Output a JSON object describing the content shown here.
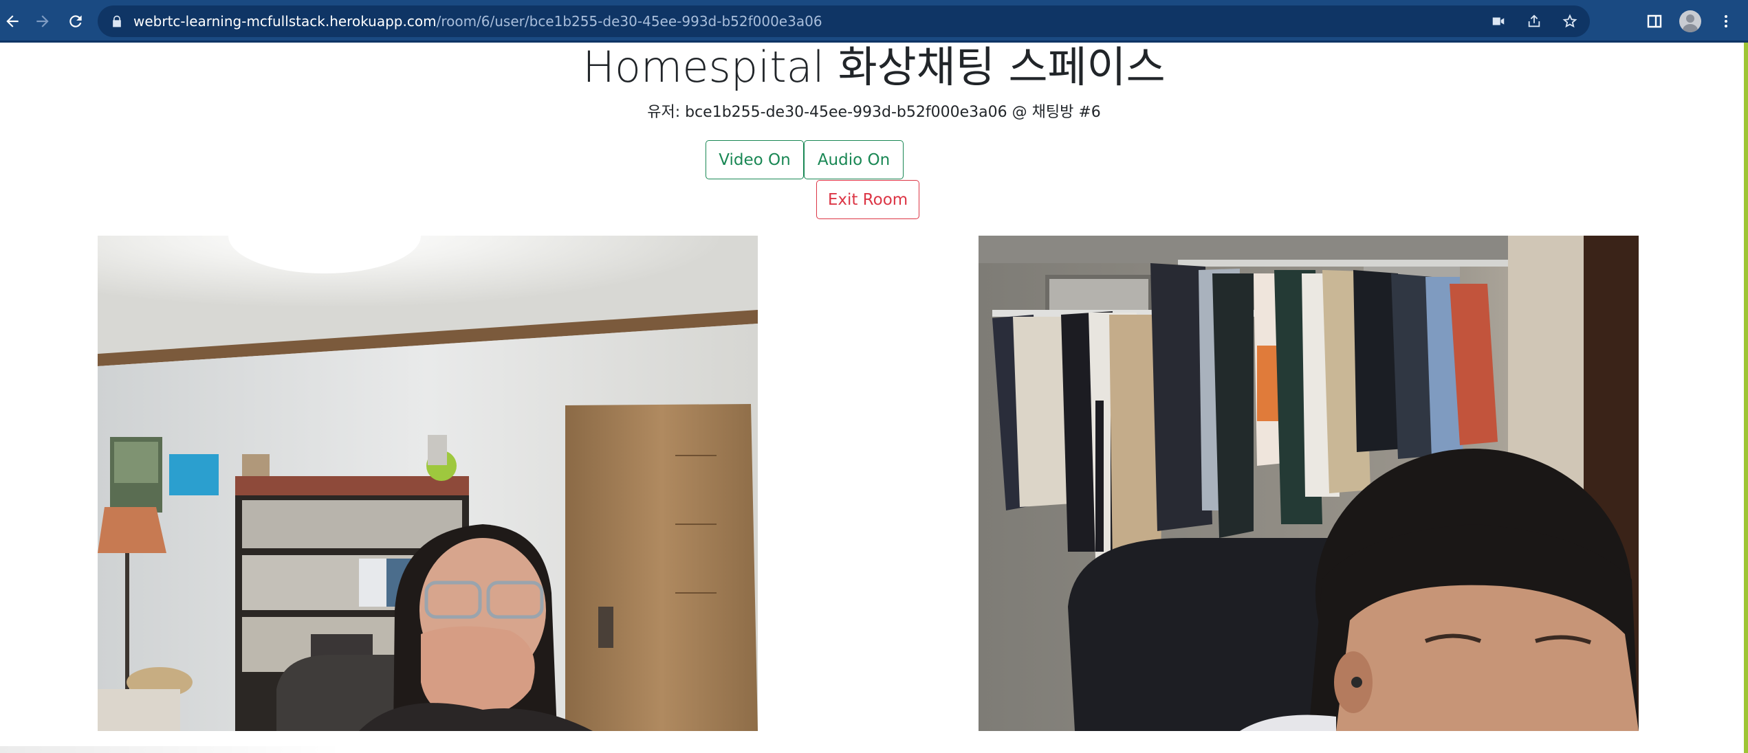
{
  "browser": {
    "url_host": "webrtc-learning-mcfullstack.herokuapp.com",
    "url_path": "/room/6/user/bce1b255-de30-45ee-993d-b52f000e3a06",
    "icons": [
      "back-arrow-icon",
      "forward-arrow-icon",
      "reload-icon",
      "lock-icon",
      "camera-icon",
      "share-icon",
      "star-icon",
      "side-panel-icon",
      "profile-avatar",
      "more-menu-icon"
    ],
    "colors": {
      "toolbar": "#1a4a82",
      "omnibox": "#0f3565"
    }
  },
  "page": {
    "title": "Homespital 화상채팅 스페이스",
    "user_info": "유저: bce1b255-de30-45ee-993d-b52f000e3a06 @ 채팅방 #6",
    "buttons": {
      "video": "Video On",
      "audio": "Audio On",
      "exit": "Exit Room"
    },
    "colors": {
      "success": "#198754",
      "danger": "#dc3545",
      "text": "#212529"
    }
  },
  "videos": [
    {
      "id": "local-video",
      "description": "webcam feed"
    },
    {
      "id": "remote-video",
      "description": "webcam feed"
    }
  ]
}
